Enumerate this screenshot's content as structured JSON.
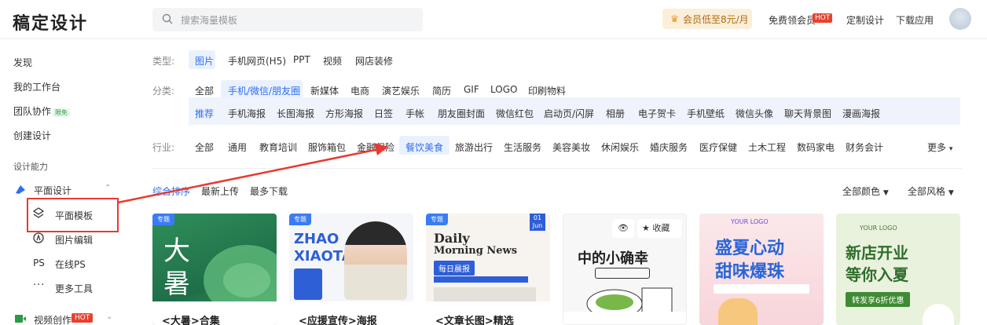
{
  "header": {
    "logo": "稿定设计",
    "search_placeholder": "搜索海量模板",
    "vip_label": "会员低至8元/月",
    "free_vip": "免费领会员",
    "hot_badge": "HOT",
    "custom_design": "定制设计",
    "download_app": "下载应用"
  },
  "sidebar": {
    "discover": "发现",
    "workspace": "我的工作台",
    "team": "团队协作",
    "team_badge": "限免",
    "create": "创建设计",
    "ability": "设计能力",
    "graphic": "平面设计",
    "sub": [
      "平面模板",
      "图片编辑",
      "在线PS",
      "更多工具"
    ],
    "sub_icons": [
      "layers-icon",
      "compass-icon",
      "ps-icon",
      "more-icon"
    ],
    "ps_glyph": "PS",
    "video": "视频创作",
    "video_badge": "HOT"
  },
  "filters": {
    "type_label": "类型:",
    "types": [
      "图片",
      "手机网页(H5)",
      "PPT",
      "视频",
      "网店装修"
    ],
    "cat_label": "分类:",
    "cats": [
      "全部",
      "手机/微信/朋友圈",
      "新媒体",
      "电商",
      "演艺娱乐",
      "简历",
      "GIF",
      "LOGO",
      "印刷物料"
    ],
    "subcats": [
      "推荐",
      "手机海报",
      "长图海报",
      "方形海报",
      "日签",
      "手帐",
      "朋友圈封面",
      "微信红包",
      "启动页/闪屏",
      "相册",
      "电子贺卡",
      "手机壁纸",
      "微信头像",
      "聊天背景图",
      "漫画海报"
    ],
    "ind_label": "行业:",
    "industries": [
      "全部",
      "通用",
      "教育培训",
      "服饰箱包",
      "金融保险",
      "餐饮美食",
      "旅游出行",
      "生活服务",
      "美容美妆",
      "休闲娱乐",
      "婚庆服务",
      "医疗保健",
      "土木工程",
      "数码家电",
      "财务会计"
    ],
    "more": "更多"
  },
  "sort": {
    "options": [
      "综合排序",
      "最新上传",
      "最多下载"
    ],
    "all_colors": "全部颜色",
    "all_styles": "全部风格"
  },
  "cards": [
    {
      "tag": "专题",
      "big1": "大",
      "big2": "暑",
      "caption": "<大暑>合集"
    },
    {
      "tag": "专题",
      "t1": "ZHAO",
      "t2": "XIAOTA",
      "caption": "<应援宣传>海报"
    },
    {
      "tag": "专题",
      "t1": "Daily",
      "t2": "Morning News",
      "t3": "每日晨报",
      "date1": "01",
      "date2": "Jun",
      "caption": "<文章长图>精选"
    },
    {
      "save": "收藏",
      "t1": "中的小确幸"
    },
    {
      "logo": "YOUR LOGO",
      "t1": "盛夏心动",
      "t2": "甜味爆珠"
    },
    {
      "logo": "YOUR LOGO",
      "t1": "新店开业",
      "t2": "等你入夏",
      "t3": "转发享6折优惠"
    }
  ],
  "colors": {
    "accent": "#2f6ef0",
    "hot": "#e8412f",
    "annotation": "#e83a30"
  }
}
